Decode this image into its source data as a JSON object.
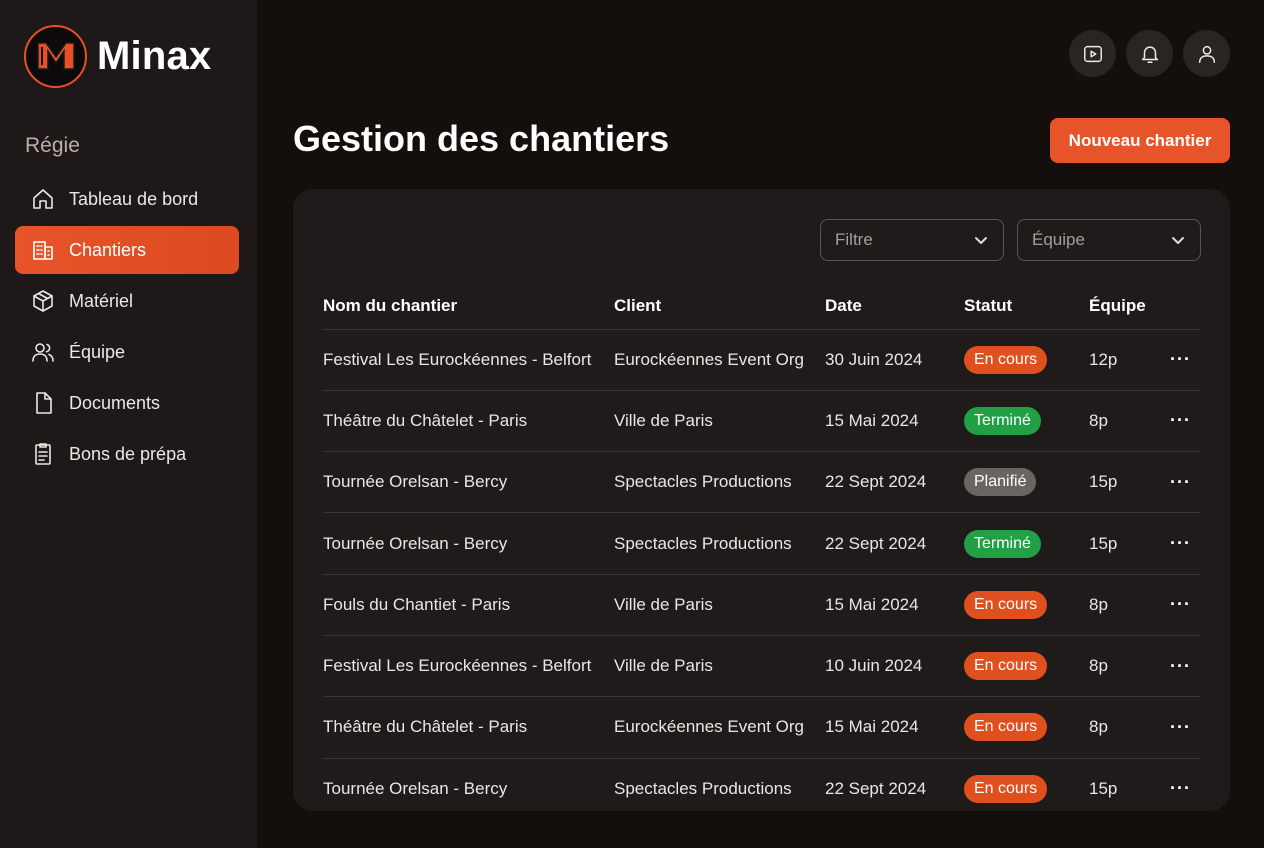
{
  "brand": {
    "name": "Minax",
    "logo_text": "MB"
  },
  "sidebar": {
    "section": "Régie",
    "items": [
      {
        "label": "Tableau de bord",
        "icon": "home-icon",
        "active": false
      },
      {
        "label": "Chantiers",
        "icon": "building-icon",
        "active": true
      },
      {
        "label": "Matériel",
        "icon": "box-icon",
        "active": false
      },
      {
        "label": "Équipe",
        "icon": "users-icon",
        "active": false
      },
      {
        "label": "Documents",
        "icon": "document-icon",
        "active": false
      },
      {
        "label": "Bons de prépa",
        "icon": "clipboard-icon",
        "active": false
      }
    ]
  },
  "header": {
    "icons": [
      "video-icon",
      "bell-icon",
      "user-icon"
    ],
    "title": "Gestion des chantiers",
    "new_button": "Nouveau chantier"
  },
  "filters": {
    "filter_placeholder": "Filtre",
    "team_placeholder": "Équipe"
  },
  "table": {
    "columns": [
      "Nom du chantier",
      "Client",
      "Date",
      "Statut",
      "Équipe"
    ],
    "rows": [
      {
        "name": "Festival Les Eurockéennes - Belfort",
        "client": "Eurockéennes Event Org",
        "date": "30 Juin 2024",
        "status": "En cours",
        "team": "12p"
      },
      {
        "name": "Théâtre du Châtelet - Paris",
        "client": "Ville de Paris",
        "date": "15 Mai 2024",
        "status": "Terminé",
        "team": "8p"
      },
      {
        "name": "Tournée Orelsan - Bercy",
        "client": "Spectacles Productions",
        "date": "22 Sept 2024",
        "status": "Planifié",
        "team": "15p"
      },
      {
        "name": "Tournée Orelsan - Bercy",
        "client": "Spectacles Productions",
        "date": "22 Sept 2024",
        "status": "Terminé",
        "team": "15p"
      },
      {
        "name": "Fouls du Chantiet - Paris",
        "client": "Ville de Paris",
        "date": "15 Mai 2024",
        "status": "En cours",
        "team": "8p"
      },
      {
        "name": "Festival Les Eurockéennes - Belfort",
        "client": "Ville de Paris",
        "date": "10 Juin 2024",
        "status": "En cours",
        "team": "8p"
      },
      {
        "name": "Théâtre du Châtelet - Paris",
        "client": "Eurockéennes Event Org",
        "date": "15 Mai 2024",
        "status": "En cours",
        "team": "8p"
      },
      {
        "name": "Tournée Orelsan - Bercy",
        "client": "Spectacles Productions",
        "date": "22 Sept 2024",
        "status": "En cours",
        "team": "15p"
      }
    ],
    "more_label": "···"
  },
  "colors": {
    "accent": "#e8542a",
    "status_en_cours": "#e0501f",
    "status_termine": "#21a046",
    "status_planifie": "#6a6462"
  }
}
